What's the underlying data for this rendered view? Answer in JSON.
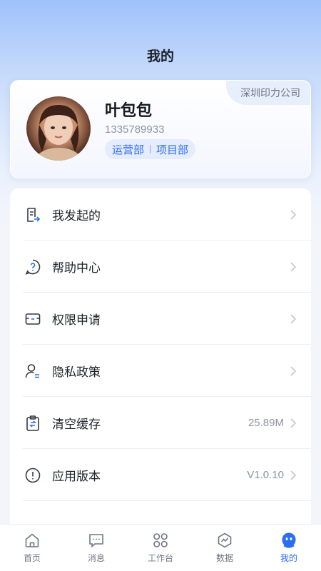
{
  "header": {
    "title": "我的"
  },
  "profile": {
    "company": "深圳印力公司",
    "name": "叶包包",
    "phone": "1335789933",
    "departments": [
      "运营部",
      "项目部"
    ]
  },
  "menu": [
    {
      "label": "我发起的",
      "icon": "my-requests-icon",
      "value": ""
    },
    {
      "label": "帮助中心",
      "icon": "help-icon",
      "value": ""
    },
    {
      "label": "权限申请",
      "icon": "permission-icon",
      "value": ""
    },
    {
      "label": "隐私政策",
      "icon": "privacy-icon",
      "value": ""
    },
    {
      "label": "清空缓存",
      "icon": "clear-cache-icon",
      "value": "25.89M"
    },
    {
      "label": "应用版本",
      "icon": "info-icon",
      "value": "V1.0.10"
    }
  ],
  "bottom_nav": [
    {
      "label": "首页",
      "icon": "home-icon",
      "active": false
    },
    {
      "label": "消息",
      "icon": "message-icon",
      "active": false
    },
    {
      "label": "工作台",
      "icon": "workbench-icon",
      "active": false
    },
    {
      "label": "数据",
      "icon": "data-icon",
      "active": false
    },
    {
      "label": "我的",
      "icon": "profile-icon",
      "active": true
    }
  ],
  "colors": {
    "accent": "#2c6ef2",
    "text": "#1f2329",
    "muted": "#8d939e"
  }
}
